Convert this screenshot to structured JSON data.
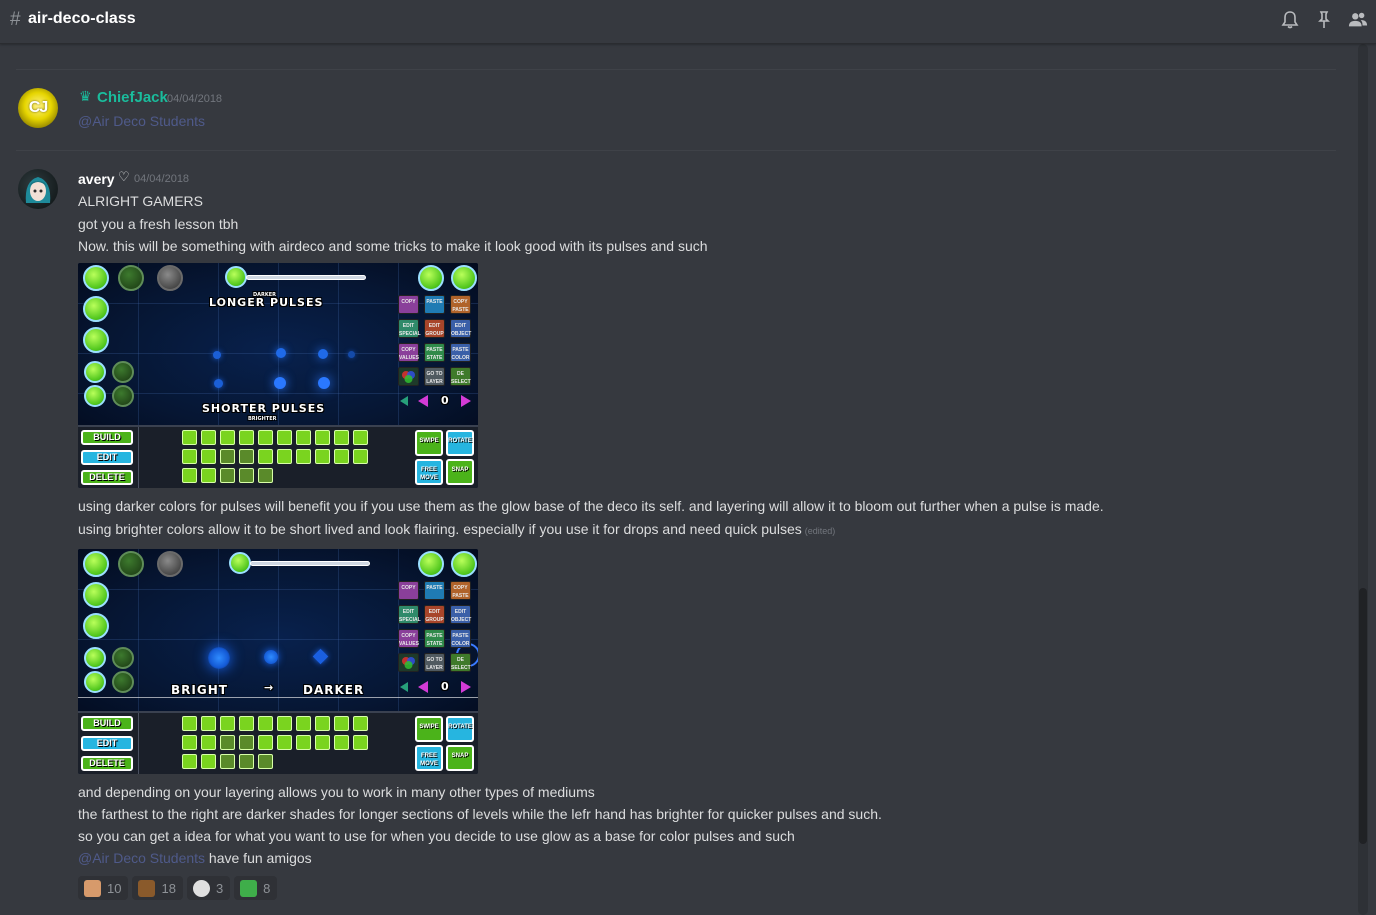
{
  "header": {
    "hash": "#",
    "channel": "air-deco-class",
    "icons": [
      "bell-icon",
      "pin-icon",
      "members-icon"
    ]
  },
  "messages": [
    {
      "author": "ChiefJack",
      "author_icon": "crown-icon",
      "author_color": "#1abc9c",
      "timestamp": "04/04/2018",
      "avatar_text": "CJ",
      "mention": "@Air Deco Students"
    },
    {
      "author": "avery",
      "author_icon": "heart-icon",
      "author_color": "#ffffff",
      "timestamp": "04/04/2018",
      "lines": [
        "ALRIGHT GAMERS",
        "got you a fresh lesson tbh",
        "Now. this will be something with airdeco and some tricks to make it look good with its pulses and such"
      ],
      "image1": {
        "label_top_small": "DARKER",
        "label_top": "LONGER PULSES",
        "label_bottom": "SHORTER PULSES",
        "label_bottom_small": "BRIGHTER",
        "counter": "0",
        "modes": [
          "BUILD",
          "EDIT",
          "DELETE"
        ],
        "side_buttons": [
          "SWIPE",
          "ROTATE",
          "FREE MOVE",
          "SNAP"
        ],
        "edit_buttons": [
          "COPY",
          "PASTE",
          "COPY PASTE",
          "EDIT SPECIAL",
          "EDIT GROUP",
          "EDIT OBJECT",
          "COPY VALUES",
          "PASTE STATE",
          "PASTE COLOR",
          "",
          "GO TO LAYER",
          "DE SELECT"
        ]
      },
      "lines2": [
        "using darker colors for pulses will benefit you if you use them as the glow base of the deco its self. and layering will allow it to bloom out further when a pulse is made.",
        "using brighter colors allow it to be short lived and look flairing. especially if you use it for drops and need quick pulses"
      ],
      "edited": "(edited)",
      "image2": {
        "label_left": "BRIGHT",
        "label_arrow": "→",
        "label_right": "DARKER",
        "counter": "0",
        "modes": [
          "BUILD",
          "EDIT",
          "DELETE"
        ],
        "side_buttons": [
          "SWIPE",
          "ROTATE",
          "FREE MOVE",
          "SNAP"
        ],
        "edit_buttons": [
          "COPY",
          "PASTE",
          "COPY PASTE",
          "EDIT SPECIAL",
          "EDIT GROUP",
          "EDIT OBJECT",
          "COPY VALUES",
          "PASTE STATE",
          "PASTE COLOR",
          "",
          "GO TO LAYER",
          "DE SELECT"
        ]
      },
      "lines3": [
        "and depending on your layering allows you to work in many other types of mediums",
        "the farthest to the right are darker shades for longer sections of levels while the lefr hand has brighter for quicker pulses and such.",
        "so you can get a idea for what you want to use for when you decide to use glow as a base for color pulses and such"
      ],
      "last_mention": "@Air Deco Students",
      "last_text": " have fun amigos",
      "reactions": [
        {
          "emoji": "hand-emoji",
          "count": "10",
          "color": "#d79a6b"
        },
        {
          "emoji": "face-emoji",
          "count": "18",
          "color": "#8a5a2b"
        },
        {
          "emoji": "smile-emoji",
          "count": "3",
          "color": "#e0e0e0"
        },
        {
          "emoji": "frog-emoji",
          "count": "8",
          "color": "#3fae4a"
        }
      ]
    }
  ]
}
